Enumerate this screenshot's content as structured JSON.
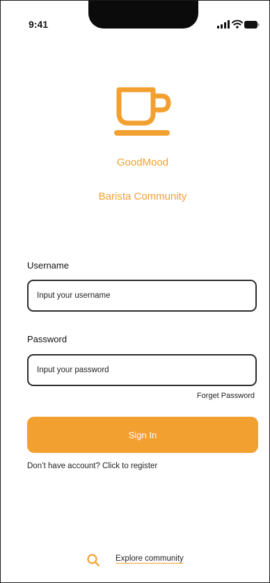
{
  "status_bar": {
    "time": "9:41"
  },
  "brand": {
    "name": "GoodMood",
    "tagline": "Barista Community",
    "logo_icon": "coffee-cup-icon"
  },
  "form": {
    "username_label": "Username",
    "username_placeholder": "Input your username",
    "username_value": "",
    "password_label": "Password",
    "password_placeholder": "Input your password",
    "password_value": "",
    "forget_password": "Forget Password",
    "sign_in": "Sign In",
    "register_prompt": "Don’t have account? Click to register"
  },
  "footer": {
    "explore_label": "Explore community",
    "explore_icon": "search-icon"
  },
  "colors": {
    "accent": "#f2a030",
    "text": "#111111",
    "border": "#2b2b2b",
    "background": "#ffffff"
  }
}
